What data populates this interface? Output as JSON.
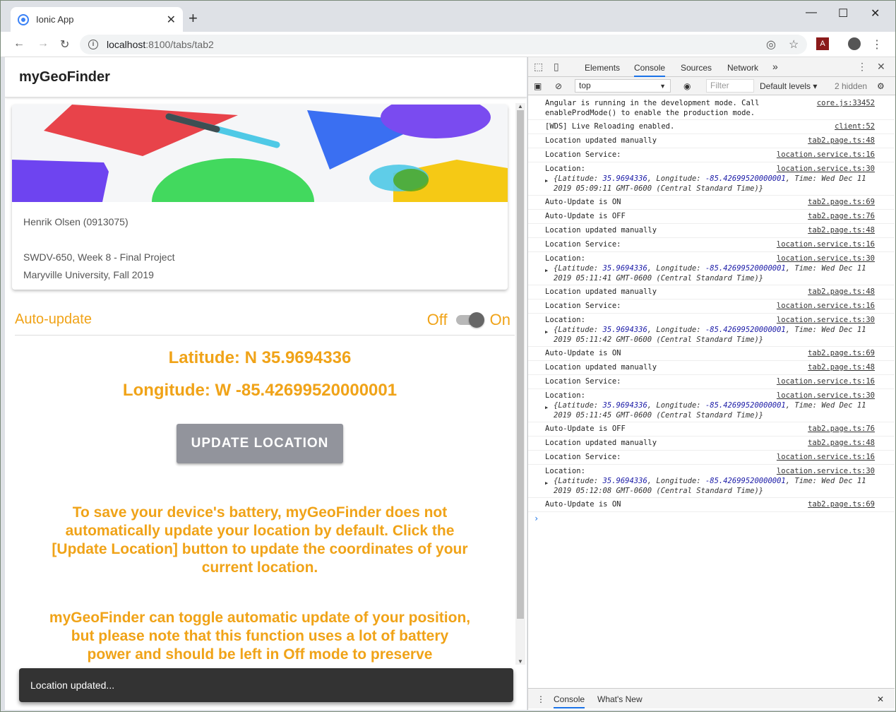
{
  "browser": {
    "tab_title": "Ionic App",
    "tab_close": "✕",
    "new_tab": "+",
    "url_host": "localhost",
    "url_path": ":8100/tabs/tab2",
    "win_min": "—",
    "win_max": "☐",
    "win_close": "✕"
  },
  "app": {
    "title": "myGeoFinder",
    "card": {
      "line1": "Henrik Olsen (0913075)",
      "line2": "SWDV-650, Week 8 - Final Project",
      "line3": "Maryville University, Fall 2019"
    },
    "auto_update_label": "Auto-update",
    "toggle_off": "Off",
    "toggle_on": "On",
    "toggle_state": true,
    "latitude": "Latitude: N 35.9694336",
    "longitude": "Longitude: W -85.42699520000001",
    "update_button": "UPDATE LOCATION",
    "para1": "To save your device's battery, myGeoFinder does not automatically update your location by default. Click the [Update Location] button to update the coordinates of your current location.",
    "para2": "myGeoFinder can toggle automatic update of your position, but please note that this function uses a lot of battery power and should be left in Off mode to preserve",
    "toast": "Location updated...",
    "accent": "#f0a318"
  },
  "devtools": {
    "tabs": [
      "Elements",
      "Console",
      "Sources",
      "Network"
    ],
    "more": "»",
    "context": "top",
    "filter_placeholder": "Filter",
    "levels": "Default levels ▾",
    "hidden": "2 hidden",
    "drawer_console": "Console",
    "drawer_whatsnew": "What's New",
    "logs": [
      {
        "text": "Angular is running in the development mode. Call enableProdMode() to enable the production mode.",
        "src": "core.js:33452"
      },
      {
        "text": "[WDS] Live Reloading enabled.",
        "src": "client:52"
      },
      {
        "text": "Location updated manually",
        "src": "tab2.page.ts:48"
      },
      {
        "text": "Location Service:",
        "src": "location.service.ts:16"
      },
      {
        "text": "Location:",
        "src": "location.service.ts:30",
        "obj": [
          "35.9694336",
          "-85.42699520000001",
          "Wed Dec 11 2019 05:09:11 GMT-0600 (Central Standard Time)"
        ]
      },
      {
        "text": "Auto-Update is ON",
        "src": "tab2.page.ts:69"
      },
      {
        "text": "Auto-Update is OFF",
        "src": "tab2.page.ts:76"
      },
      {
        "text": "Location updated manually",
        "src": "tab2.page.ts:48"
      },
      {
        "text": "Location Service:",
        "src": "location.service.ts:16"
      },
      {
        "text": "Location:",
        "src": "location.service.ts:30",
        "obj": [
          "35.9694336",
          "-85.42699520000001",
          "Wed Dec 11 2019 05:11:41 GMT-0600 (Central Standard Time)"
        ]
      },
      {
        "text": "Location updated manually",
        "src": "tab2.page.ts:48"
      },
      {
        "text": "Location Service:",
        "src": "location.service.ts:16"
      },
      {
        "text": "Location:",
        "src": "location.service.ts:30",
        "obj": [
          "35.9694336",
          "-85.42699520000001",
          "Wed Dec 11 2019 05:11:42 GMT-0600 (Central Standard Time)"
        ]
      },
      {
        "text": "Auto-Update is ON",
        "src": "tab2.page.ts:69"
      },
      {
        "text": "Location updated manually",
        "src": "tab2.page.ts:48"
      },
      {
        "text": "Location Service:",
        "src": "location.service.ts:16"
      },
      {
        "text": "Location:",
        "src": "location.service.ts:30",
        "obj": [
          "35.9694336",
          "-85.42699520000001",
          "Wed Dec 11 2019 05:11:45 GMT-0600 (Central Standard Time)"
        ]
      },
      {
        "text": "Auto-Update is OFF",
        "src": "tab2.page.ts:76"
      },
      {
        "text": "Location updated manually",
        "src": "tab2.page.ts:48"
      },
      {
        "text": "Location Service:",
        "src": "location.service.ts:16"
      },
      {
        "text": "Location:",
        "src": "location.service.ts:30",
        "obj": [
          "35.9694336",
          "-85.42699520000001",
          "Wed Dec 11 2019 05:12:08 GMT-0600 (Central Standard Time)"
        ]
      },
      {
        "text": "Auto-Update is ON",
        "src": "tab2.page.ts:69"
      }
    ],
    "prompt": "›"
  }
}
